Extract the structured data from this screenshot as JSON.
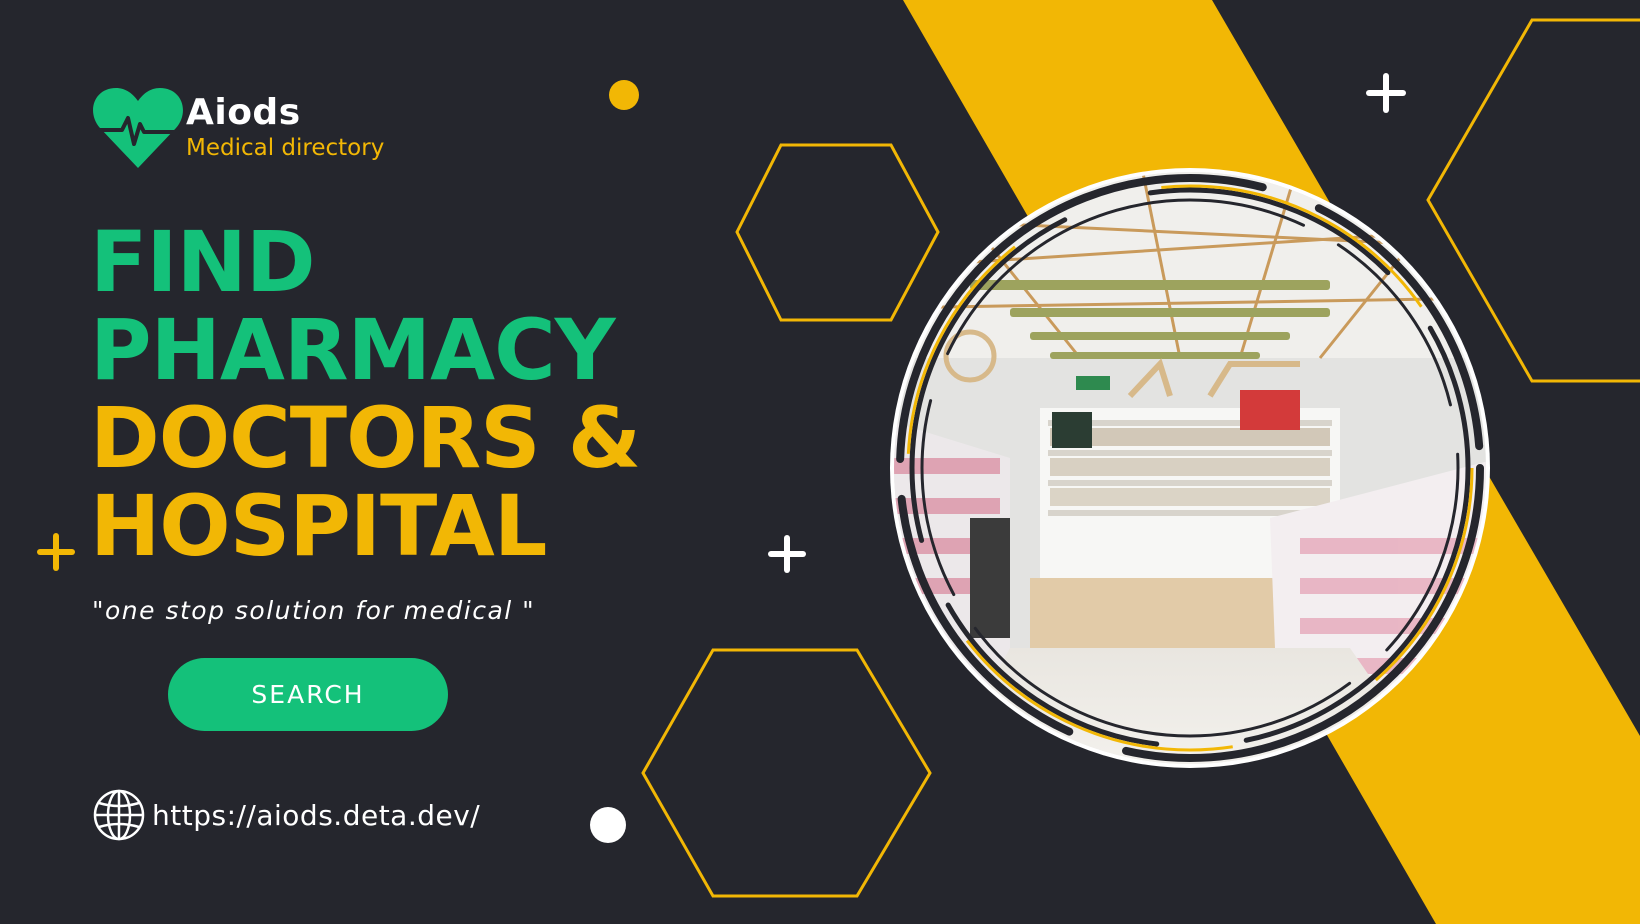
{
  "brand": {
    "name": "Aiods",
    "tagline": "Medical directory"
  },
  "headline": {
    "line1": "FIND",
    "line2": "PHARMACY",
    "line3": "DOCTORS &",
    "line4": "HOSPITAL"
  },
  "tagline": "\"one stop solution for medical \"",
  "search_button": {
    "label": "SEARCH"
  },
  "website": {
    "url": "https://aiods.deta.dev/"
  },
  "colors": {
    "background": "#25262d",
    "accent_green": "#14c17a",
    "accent_yellow": "#f2b705",
    "text_white": "#ffffff"
  },
  "icons": {
    "logo": "heart-pulse-icon",
    "globe": "globe-icon",
    "decor_plus": "plus-icon"
  }
}
